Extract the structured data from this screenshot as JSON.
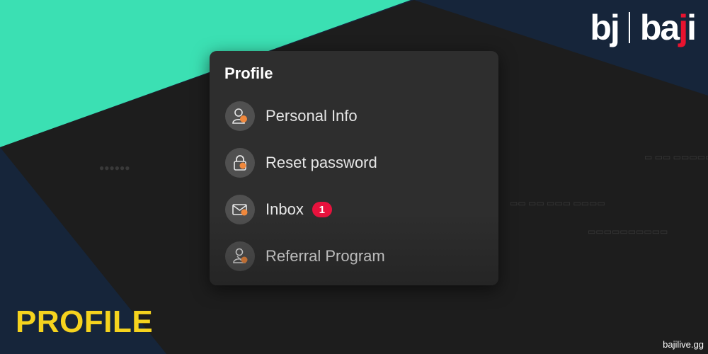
{
  "colors": {
    "teal_band": "#3be0b3",
    "navy": "#16253a",
    "dark_screen": "#1c1c1c",
    "panel_bg": "#2e2e2e",
    "icon_circle": "#505050",
    "icon_accent": "#f0883c",
    "badge_red": "#e8123d",
    "caption_yellow": "#f5d31e",
    "logo_red_dot": "#e8132f"
  },
  "logo": {
    "left_mark": "bj",
    "right_word_part1": "ba",
    "right_word_part2": "ji"
  },
  "profile_menu": {
    "title": "Profile",
    "items": [
      {
        "label": "Personal Info",
        "icon": "person-icon"
      },
      {
        "label": "Reset password",
        "icon": "lock-icon"
      },
      {
        "label": "Inbox",
        "icon": "envelope-icon",
        "badge": "1"
      },
      {
        "label": "Referral Program",
        "icon": "referral-icon"
      }
    ]
  },
  "caption": "PROFILE",
  "site_link": "bajilive.gg"
}
